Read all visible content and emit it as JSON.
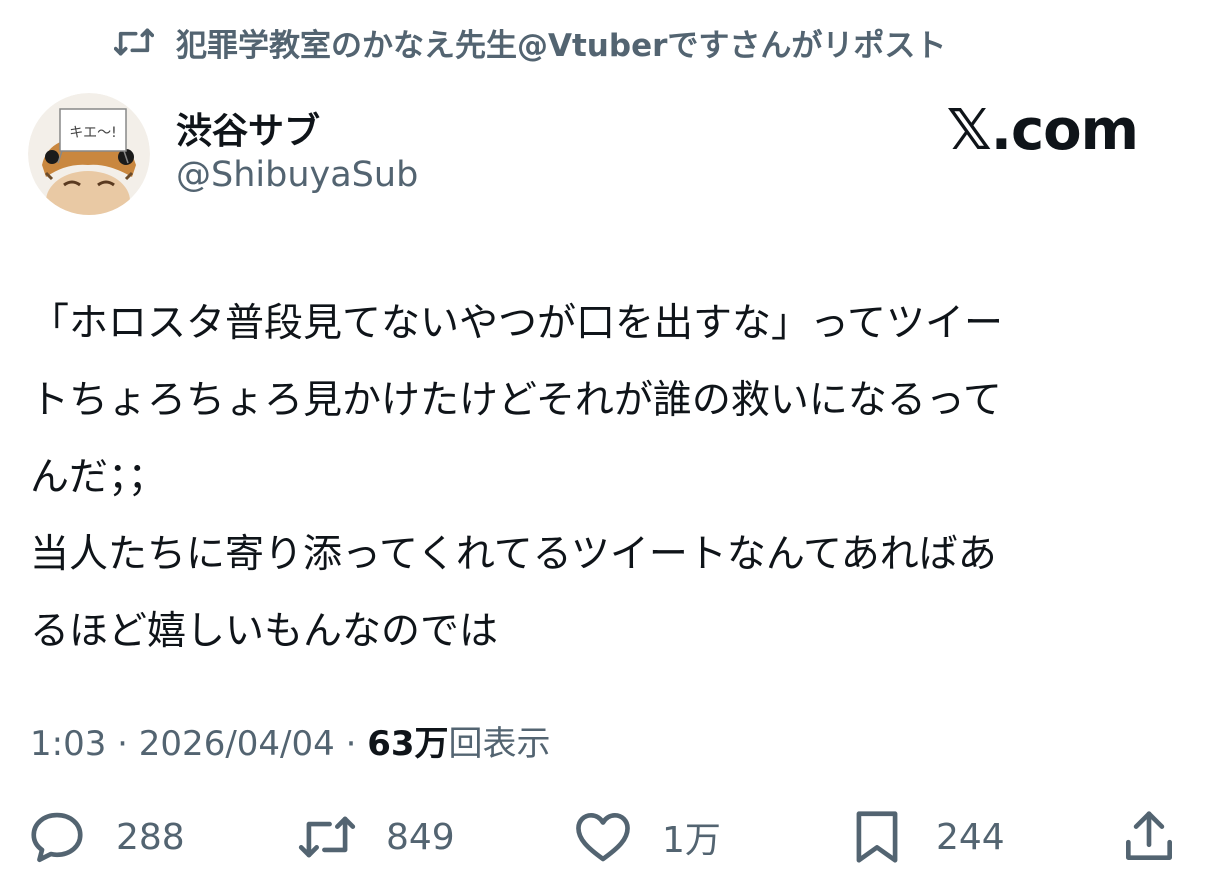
{
  "repost_banner": {
    "icon": "repost-icon",
    "text": "犯罪学教室のかなえ先生@Vtuberですさんがリポスト"
  },
  "author": {
    "avatar": "avatar",
    "avatar_sign": "キエ〜!",
    "name": "渋谷サブ",
    "handle": "@ShibuyaSub"
  },
  "watermark": "𝕏.com",
  "tweet": {
    "lines": [
      "「ホロスタ普段見てないやつが口を出すな」ってツイー",
      "トちょろちょろ見かけたけどそれが誰の救いになるって",
      "んだ；；",
      "当人たちに寄り添ってくれてるツイートなんてあればあ",
      "るほど嬉しいもんなのでは"
    ]
  },
  "meta": {
    "time": "1:03",
    "separator": " · ",
    "date": "2026/04/04",
    "views_count": "63万",
    "views_label": "回表示"
  },
  "actions": {
    "reply": {
      "icon": "reply-icon",
      "count": "288"
    },
    "repost": {
      "icon": "repost-icon",
      "count": "849"
    },
    "like": {
      "icon": "heart-icon",
      "count": "1万"
    },
    "bookmark": {
      "icon": "bookmark-icon",
      "count": "244"
    },
    "share": {
      "icon": "share-icon"
    }
  },
  "colors": {
    "text_primary": "#0f1419",
    "text_secondary": "#536471",
    "background": "#ffffff"
  }
}
